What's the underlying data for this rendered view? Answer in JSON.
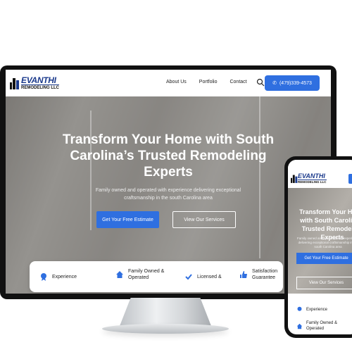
{
  "brand": {
    "name_line1": "EVANTHI",
    "name_line2": "REMODELING LLC"
  },
  "nav": {
    "items": [
      "About Us",
      "Portfolio",
      "Contact"
    ],
    "phone": "(479)339-4573",
    "icons": {
      "search": "search-icon",
      "phone": "phone-icon"
    }
  },
  "hero": {
    "title": "Transform Your Home with South Carolina’s Trusted Remodeling Experts",
    "subtitle": "Family owned and operated with experience delivering exceptional craftsmanship in the south Carolina area",
    "cta_primary": "Get Your Free Estimate",
    "cta_secondary": "View Our Services"
  },
  "features": [
    {
      "label": "Experience",
      "icon": "badge-icon"
    },
    {
      "label": "Family Owned & Operated",
      "icon": "home-icon"
    },
    {
      "label": "Licensed &",
      "icon": "check-icon"
    },
    {
      "label": "Satisfaction Guarantee",
      "icon": "thumbs-up-icon"
    }
  ],
  "mobile": {
    "title": "Transform Your Home with South Carolina's Trusted Remodeling Experts",
    "subtitle": "Family owned and operated with experience delivering exceptional craftsmanship in the south Carolina area",
    "cta_primary": "Get Your Free Estimate",
    "cta_secondary": "View Our Services",
    "features": [
      "Experience",
      "Family Owned & Operated"
    ]
  },
  "colors": {
    "accent": "#2f6fe0",
    "brand": "#1b3a8c"
  }
}
